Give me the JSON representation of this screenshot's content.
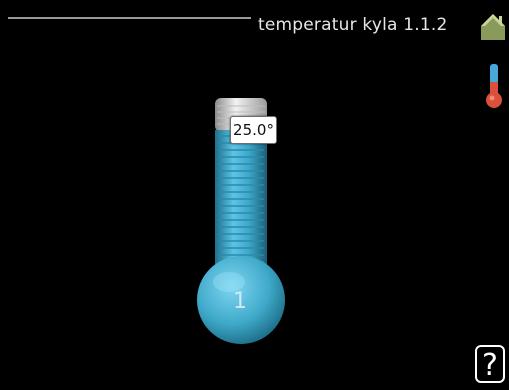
{
  "header": {
    "title": "temperatur kyla 1.1.2",
    "home_icon": "home-icon",
    "mode_icon": "thermometer-mode-icon"
  },
  "thermometer": {
    "value": "25.0°",
    "circuit_number": "1",
    "fill_color": "#3fa9c9"
  },
  "help": {
    "label": "?"
  }
}
